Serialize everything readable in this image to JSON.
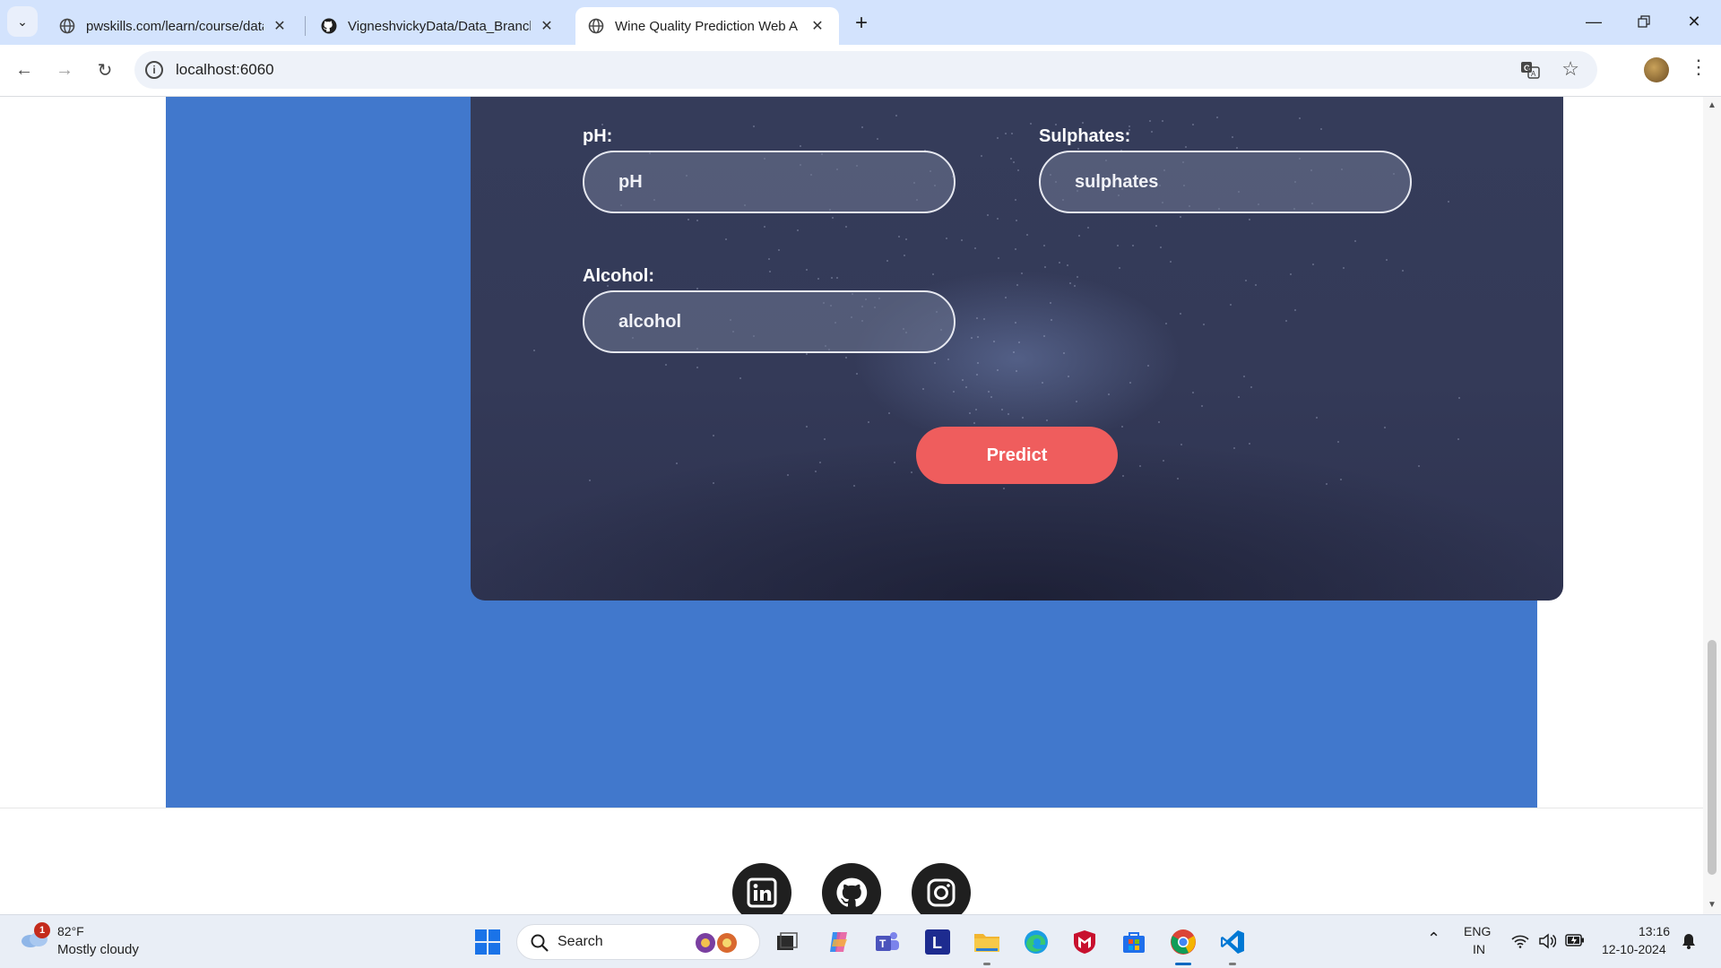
{
  "browser": {
    "tabs": [
      {
        "title": "pwskills.com/learn/course/data",
        "active": false
      },
      {
        "title": "VigneshvickyData/Data_Branchi",
        "active": false
      },
      {
        "title": "Wine Quality Prediction Web A",
        "active": true
      }
    ],
    "url": "localhost:6060"
  },
  "form": {
    "ph_label": "pH:",
    "ph_placeholder": "pH",
    "sulphates_label": "Sulphates:",
    "sulphates_placeholder": "sulphates",
    "alcohol_label": "Alcohol:",
    "alcohol_placeholder": "alcohol",
    "predict_label": "Predict"
  },
  "footer": {
    "social_links": [
      "linkedin-icon",
      "github-icon",
      "instagram-icon"
    ]
  },
  "taskbar": {
    "weather_badge": "1",
    "weather_temp": "82°F",
    "weather_desc": "Mostly cloudy",
    "search_placeholder": "Search",
    "lang_top": "ENG",
    "lang_bottom": "IN",
    "time": "13:16",
    "date": "12-10-2024"
  },
  "colors": {
    "page_blue": "#4178cc",
    "card_dark": "#343a58",
    "predict_red": "#ef5d5d"
  }
}
